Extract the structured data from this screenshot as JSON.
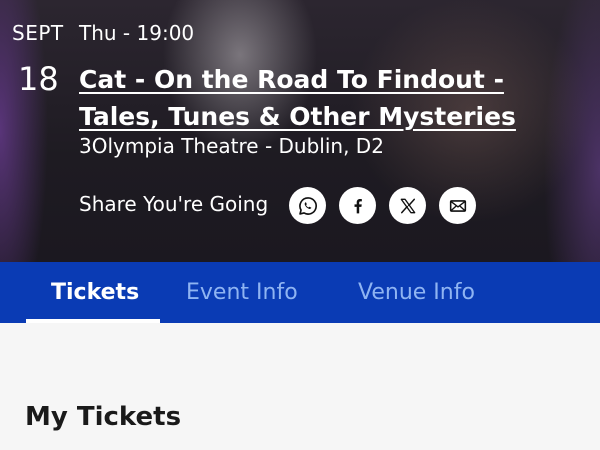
{
  "event": {
    "month": "SEPT",
    "day_time": "Thu - 19:00",
    "day": "18",
    "title": "Cat - On the Road To Findout - Tales, Tunes & Other Mysteries",
    "venue": "3Olympia Theatre - Dublin, D2"
  },
  "share": {
    "label": "Share You're Going",
    "buttons": [
      "whatsapp-icon",
      "facebook-icon",
      "x-icon",
      "email-icon"
    ]
  },
  "tabs": [
    {
      "label": "Tickets",
      "active": true
    },
    {
      "label": "Event Info",
      "active": false
    },
    {
      "label": "Venue Info",
      "active": false
    }
  ],
  "my_tickets": {
    "heading": "My Tickets"
  },
  "colors": {
    "tab_bar": "#0a3bb4",
    "tab_inactive_text": "#8fb4f2",
    "page_background": "#f6f6f6"
  }
}
